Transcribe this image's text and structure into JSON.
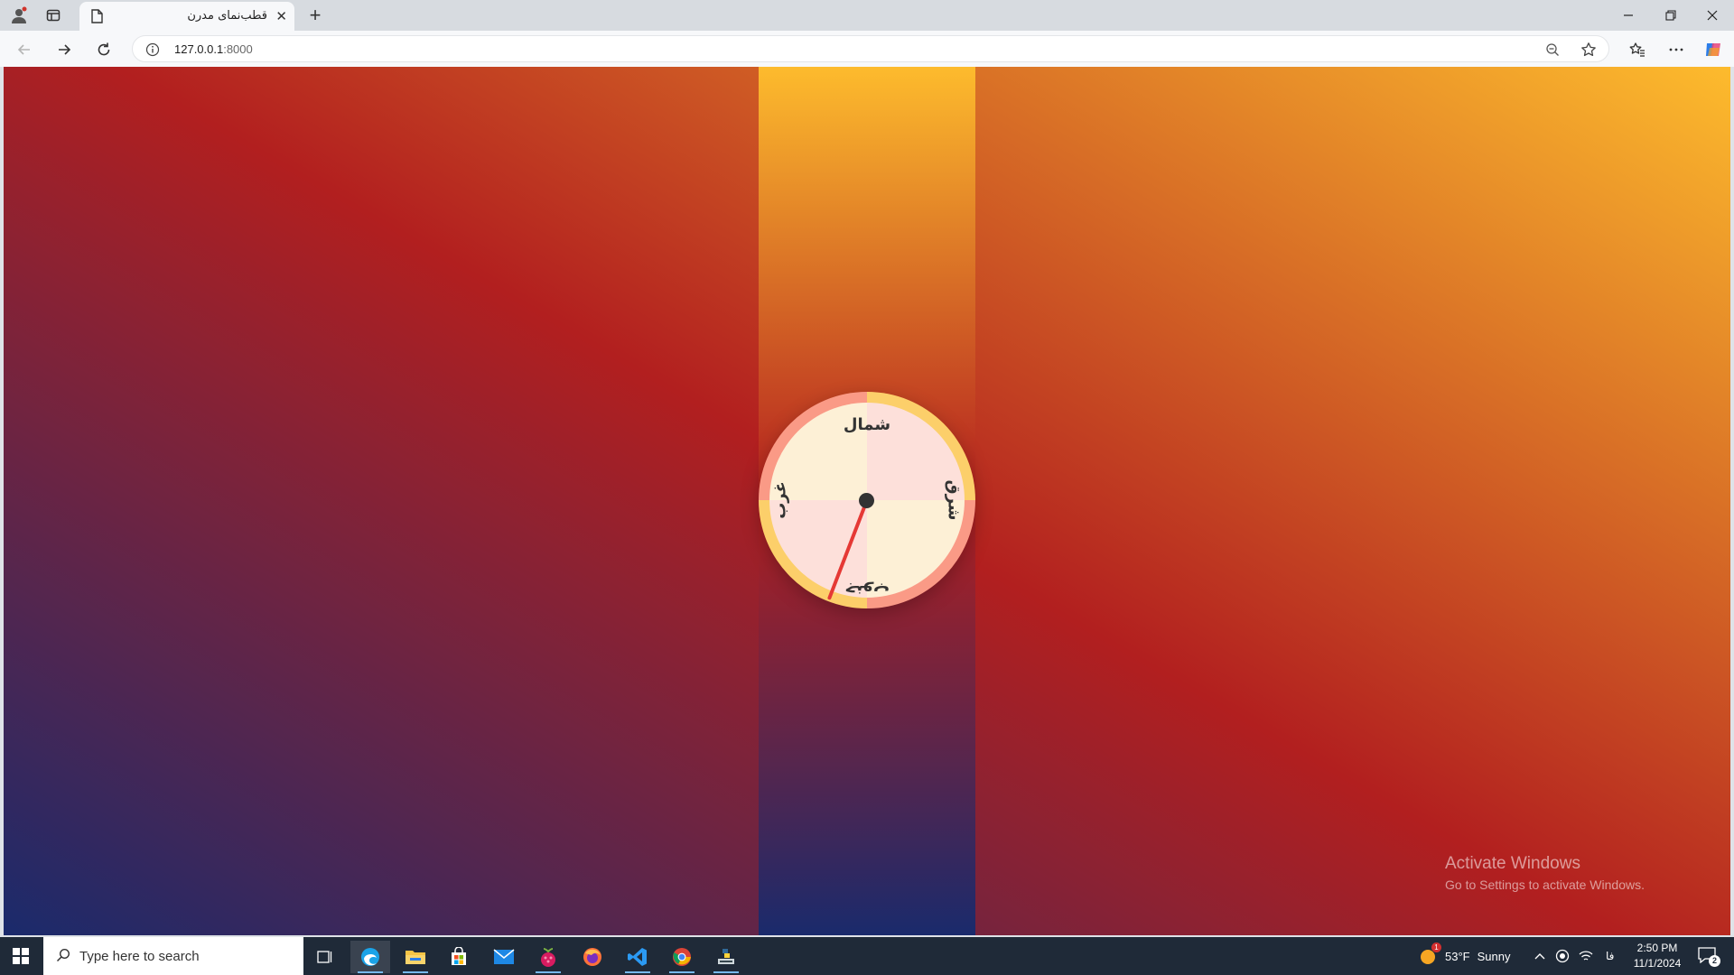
{
  "browser": {
    "tab_title": "قطب‌نمای مدرن",
    "url_host": "127.0.0.1",
    "url_port": ":8000"
  },
  "compass": {
    "north": "شمال",
    "south": "جنوب",
    "east": "شرق",
    "west": "غرب",
    "needle_heading_deg": 201
  },
  "watermark": {
    "line1": "Activate Windows",
    "line2": "Go to Settings to activate Windows."
  },
  "taskbar": {
    "search_placeholder": "Type here to search",
    "weather_temp": "53°F",
    "weather_text": "Sunny",
    "weather_badge": "1",
    "lang": "فا",
    "time": "2:50 PM",
    "date": "11/1/2024",
    "notifications": "2"
  },
  "colors": {
    "gradient_start": "#1a2a6c",
    "gradient_mid": "#b21f1f",
    "gradient_end": "#fdbb2d",
    "needle": "#e53935"
  }
}
